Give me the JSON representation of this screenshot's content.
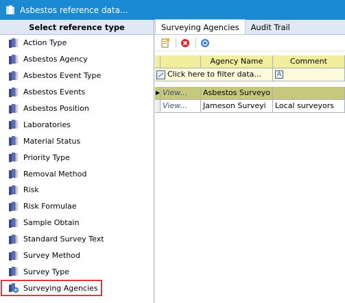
{
  "window": {
    "title": "Asbestos reference data..."
  },
  "sidebar": {
    "header": "Select reference type",
    "items": [
      {
        "label": "Action Type"
      },
      {
        "label": "Asbestos Agency"
      },
      {
        "label": "Asbestos Event Type"
      },
      {
        "label": "Asbestos Events"
      },
      {
        "label": "Asbestos Position"
      },
      {
        "label": "Laboratories"
      },
      {
        "label": "Material Status"
      },
      {
        "label": "Priority Type"
      },
      {
        "label": "Removal Method"
      },
      {
        "label": "Risk"
      },
      {
        "label": "Risk Formulae"
      },
      {
        "label": "Sample Obtain"
      },
      {
        "label": "Standard Survey Text"
      },
      {
        "label": "Survey Method"
      },
      {
        "label": "Survey Type"
      },
      {
        "label": "Surveying Agencies",
        "selected": true
      }
    ]
  },
  "tabs": [
    {
      "label": "Surveying Agencies",
      "active": true
    },
    {
      "label": "Audit Trail",
      "active": false
    }
  ],
  "toolbar": {
    "icons": [
      "new-record-icon",
      "delete-icon",
      "help-icon"
    ]
  },
  "grid": {
    "columns": [
      "",
      "Agency Name",
      "Comment"
    ],
    "filter_text": "Click here to filter data...",
    "rows": [
      {
        "view": "View...",
        "name": "Asbestos Surveyo",
        "comment": "",
        "selected": true
      },
      {
        "view": "View...",
        "name": "Jameson Surveyi",
        "comment": "Local surveyors",
        "selected": false
      }
    ]
  },
  "colors": {
    "titlebar": "#1a8ad4",
    "header_bg": "#dfe8f4",
    "grid_header": "#f1ee9e",
    "selected_row": "#c7c87b",
    "highlight_border": "#e0393a"
  }
}
